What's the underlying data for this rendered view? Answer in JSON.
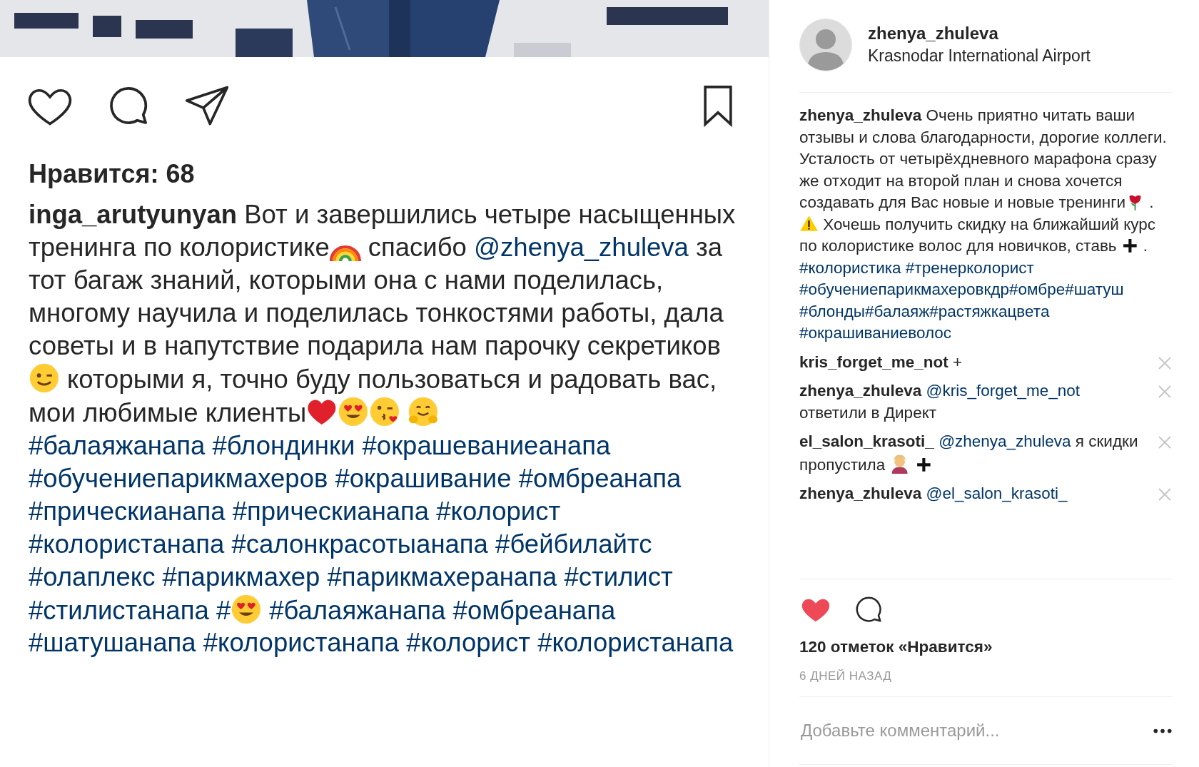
{
  "left_post": {
    "liked": false,
    "saved": false,
    "likes": "Нравится: 68",
    "caption": [
      {
        "kind": "user",
        "text": "inga_arutyunyan"
      },
      {
        "kind": "text",
        "text": " Вот и завершились четыре насыщенных тренинга по колористике"
      },
      {
        "kind": "rainbow"
      },
      {
        "kind": "text",
        "text": " спасибо "
      },
      {
        "kind": "mention",
        "text": "@zhenya_zhuleva"
      },
      {
        "kind": "text",
        "text": "  за тот багаж знаний, которыми она с нами поделилась, многому научила и поделилась тонкостями работы, дала советы и в напутствие подарила нам парочку секретиков"
      },
      {
        "kind": "wink"
      },
      {
        "kind": "text",
        "text": " которыми я, точно буду пользоваться и радовать вас, мои любимые клиенты"
      },
      {
        "kind": "heart"
      },
      {
        "kind": "hearteyes"
      },
      {
        "kind": "kiss"
      },
      {
        "kind": "gap"
      },
      {
        "kind": "hug"
      },
      {
        "kind": "break"
      },
      {
        "kind": "tag",
        "text": "#балаяжанапа"
      },
      {
        "kind": "gap"
      },
      {
        "kind": "tag",
        "text": "#блондинки"
      },
      {
        "kind": "gap"
      },
      {
        "kind": "tag",
        "text": "#окрашеваниеанапа"
      },
      {
        "kind": "gap"
      },
      {
        "kind": "tag",
        "text": "#обучениепарикмахеров"
      },
      {
        "kind": "gap"
      },
      {
        "kind": "tag",
        "text": "#окрашивание"
      },
      {
        "kind": "gap"
      },
      {
        "kind": "tag",
        "text": "#омбреанапа"
      },
      {
        "kind": "gap"
      },
      {
        "kind": "tag",
        "text": "#прическианапа"
      },
      {
        "kind": "gap"
      },
      {
        "kind": "tag",
        "text": "#прическианапа"
      },
      {
        "kind": "gap"
      },
      {
        "kind": "tag",
        "text": "#колорист"
      },
      {
        "kind": "gap"
      },
      {
        "kind": "tag",
        "text": "#колористанапа"
      },
      {
        "kind": "gap"
      },
      {
        "kind": "tag",
        "text": "#салонкрасотыанапа"
      },
      {
        "kind": "gap"
      },
      {
        "kind": "tag",
        "text": "#бейбилайтс"
      },
      {
        "kind": "gap"
      },
      {
        "kind": "tag",
        "text": "#олаплекс"
      },
      {
        "kind": "gap"
      },
      {
        "kind": "tag",
        "text": "#парикмахер"
      },
      {
        "kind": "gap"
      },
      {
        "kind": "tag",
        "text": "#парикмахеранапа"
      },
      {
        "kind": "gap"
      },
      {
        "kind": "tag",
        "text": "#стилист"
      },
      {
        "kind": "gap"
      },
      {
        "kind": "tag",
        "text": "#стилистанапа"
      },
      {
        "kind": "gap"
      },
      {
        "kind": "tag",
        "text": "#"
      },
      {
        "kind": "hearteyes"
      },
      {
        "kind": "gap"
      },
      {
        "kind": "tag",
        "text": "#балаяжанапа"
      },
      {
        "kind": "gap"
      },
      {
        "kind": "tag",
        "text": "#омбреанапа"
      },
      {
        "kind": "gap"
      },
      {
        "kind": "tag",
        "text": "#шатушанапа"
      },
      {
        "kind": "gap"
      },
      {
        "kind": "tag",
        "text": "#колористанапа"
      },
      {
        "kind": "gap"
      },
      {
        "kind": "tag",
        "text": "#колорист"
      },
      {
        "kind": "gap"
      },
      {
        "kind": "tag",
        "text": "#колористанапа"
      }
    ]
  },
  "right_post": {
    "author": {
      "username": "zhenya_zhuleva",
      "location": "Krasnodar International Airport"
    },
    "caption": [
      {
        "kind": "user",
        "text": "zhenya_zhuleva"
      },
      {
        "kind": "text",
        "text": " Очень приятно читать ваши отзывы и слова благодарности, дорогие коллеги. Усталость от четырёхдневного марафона сразу же отходит на второй план и снова хочется создавать для Вас новые и новые тренинги"
      },
      {
        "kind": "rose"
      },
      {
        "kind": "text",
        "text": " . "
      },
      {
        "kind": "warning"
      },
      {
        "kind": "text",
        "text": " Хочешь получить скидку на ближайший курс по колористике волос для новичков, ставь "
      },
      {
        "kind": "plus"
      },
      {
        "kind": "text",
        "text": " ."
      },
      {
        "kind": "break"
      },
      {
        "kind": "tag",
        "text": "#колористика"
      },
      {
        "kind": "gap"
      },
      {
        "kind": "tag",
        "text": "#тренерколорист"
      },
      {
        "kind": "tag",
        "text": "#обучениепарикмахеровкдр"
      },
      {
        "kind": "tag",
        "text": "#омбре"
      },
      {
        "kind": "tag",
        "text": "#шатуш"
      },
      {
        "kind": "tag",
        "text": "#блонды"
      },
      {
        "kind": "tag",
        "text": "#балаяж"
      },
      {
        "kind": "tag",
        "text": "#растяжкацвета"
      },
      {
        "kind": "tag",
        "text": "#окрашиваниеволос"
      }
    ],
    "comments": [
      {
        "segments": [
          {
            "kind": "user",
            "text": "kris_forget_me_not"
          },
          {
            "kind": "text",
            "text": " +"
          }
        ]
      },
      {
        "segments": [
          {
            "kind": "user",
            "text": "zhenya_zhuleva"
          },
          {
            "kind": "gap"
          },
          {
            "kind": "mention",
            "text": "@kris_forget_me_not"
          },
          {
            "kind": "text",
            "text": " ответили в Директ"
          }
        ]
      },
      {
        "segments": [
          {
            "kind": "user",
            "text": "el_salon_krasoti_"
          },
          {
            "kind": "gap"
          },
          {
            "kind": "mention",
            "text": "@zhenya_zhuleva"
          },
          {
            "kind": "text",
            "text": " я скидки пропустила "
          },
          {
            "kind": "facepalm"
          },
          {
            "kind": "gap"
          },
          {
            "kind": "plus"
          }
        ]
      },
      {
        "segments": [
          {
            "kind": "user",
            "text": "zhenya_zhuleva"
          },
          {
            "kind": "gap"
          },
          {
            "kind": "mention",
            "text": "@el_salon_krasoti_"
          }
        ]
      }
    ],
    "liked": true,
    "likes": "120 отметок «Нравится»",
    "time": "6 ДНЕЙ НАЗАД",
    "comment_field": {
      "placeholder": "Добавьте комментарий..."
    }
  }
}
